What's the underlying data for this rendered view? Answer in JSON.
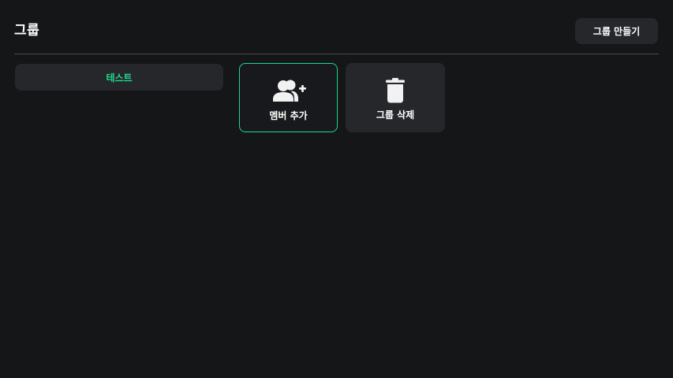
{
  "header": {
    "title": "그룹",
    "create_button_label": "그룹 만들기"
  },
  "groups": [
    {
      "name": "테스트",
      "selected": true
    }
  ],
  "actions": [
    {
      "label": "멤버 추가",
      "icon": "add-member-icon",
      "selected": true
    },
    {
      "label": "그룹 삭제",
      "icon": "trash-icon",
      "selected": false
    }
  ],
  "colors": {
    "accent": "#1ed98f",
    "background": "#151618",
    "surface": "#25272b"
  }
}
